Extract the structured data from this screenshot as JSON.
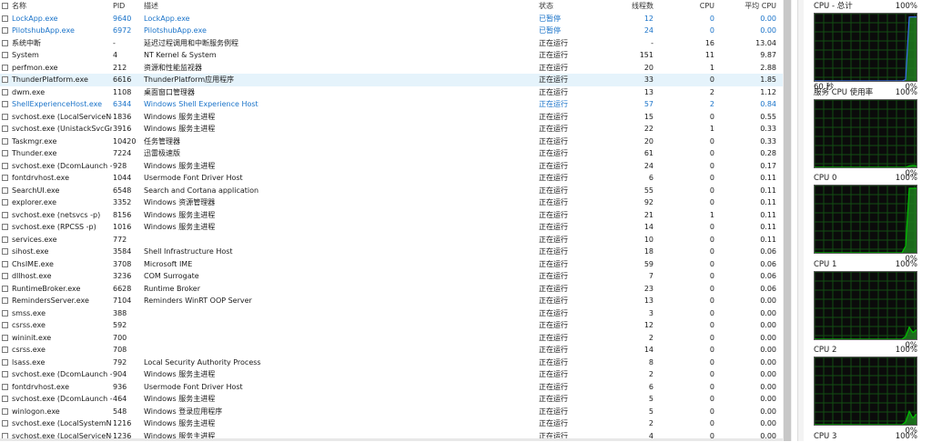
{
  "headers": {
    "name": "名称",
    "pid": "PID",
    "desc": "描述",
    "status": "状态",
    "threads": "线程数",
    "cpu": "CPU",
    "avg": "平均 CPU"
  },
  "processes": [
    {
      "name": "LockApp.exe",
      "pid": "9640",
      "desc": "LockApp.exe",
      "status": "已暂停",
      "threads": "12",
      "cpu": "0",
      "avg": "0.00",
      "suspended": true
    },
    {
      "name": "PilotshubApp.exe",
      "pid": "6972",
      "desc": "PilotshubApp.exe",
      "status": "已暂停",
      "threads": "24",
      "cpu": "0",
      "avg": "0.00",
      "suspended": true
    },
    {
      "name": "系统中断",
      "pid": "-",
      "desc": "延迟过程调用和中断服务例程",
      "status": "正在运行",
      "threads": "-",
      "cpu": "16",
      "avg": "13.04"
    },
    {
      "name": "System",
      "pid": "4",
      "desc": "NT Kernel & System",
      "status": "正在运行",
      "threads": "151",
      "cpu": "11",
      "avg": "9.87"
    },
    {
      "name": "perfmon.exe",
      "pid": "212",
      "desc": "资源和性能监视器",
      "status": "正在运行",
      "threads": "20",
      "cpu": "1",
      "avg": "2.88"
    },
    {
      "name": "ThunderPlatform.exe",
      "pid": "6616",
      "desc": "ThunderPlatform应用程序",
      "status": "正在运行",
      "threads": "33",
      "cpu": "0",
      "avg": "1.85",
      "selected": true
    },
    {
      "name": "dwm.exe",
      "pid": "1108",
      "desc": "桌面窗口管理器",
      "status": "正在运行",
      "threads": "13",
      "cpu": "2",
      "avg": "1.12"
    },
    {
      "name": "ShellExperienceHost.exe",
      "pid": "6344",
      "desc": "Windows Shell Experience Host",
      "status": "正在运行",
      "threads": "57",
      "cpu": "2",
      "avg": "0.84",
      "suspended": true
    },
    {
      "name": "svchost.exe (LocalServiceNo...",
      "pid": "1836",
      "desc": "Windows 服务主进程",
      "status": "正在运行",
      "threads": "15",
      "cpu": "0",
      "avg": "0.55"
    },
    {
      "name": "svchost.exe (UnistackSvcGro...",
      "pid": "3916",
      "desc": "Windows 服务主进程",
      "status": "正在运行",
      "threads": "22",
      "cpu": "1",
      "avg": "0.33"
    },
    {
      "name": "Taskmgr.exe",
      "pid": "10420",
      "desc": "任务管理器",
      "status": "正在运行",
      "threads": "20",
      "cpu": "0",
      "avg": "0.33"
    },
    {
      "name": "Thunder.exe",
      "pid": "7224",
      "desc": "迅雷极速版",
      "status": "正在运行",
      "threads": "61",
      "cpu": "0",
      "avg": "0.28"
    },
    {
      "name": "svchost.exe (DcomLaunch -p)",
      "pid": "928",
      "desc": "Windows 服务主进程",
      "status": "正在运行",
      "threads": "24",
      "cpu": "0",
      "avg": "0.17"
    },
    {
      "name": "fontdrvhost.exe",
      "pid": "1044",
      "desc": "Usermode Font Driver Host",
      "status": "正在运行",
      "threads": "6",
      "cpu": "0",
      "avg": "0.11"
    },
    {
      "name": "SearchUI.exe",
      "pid": "6548",
      "desc": "Search and Cortana application",
      "status": "正在运行",
      "threads": "55",
      "cpu": "0",
      "avg": "0.11"
    },
    {
      "name": "explorer.exe",
      "pid": "3352",
      "desc": "Windows 资源管理器",
      "status": "正在运行",
      "threads": "92",
      "cpu": "0",
      "avg": "0.11"
    },
    {
      "name": "svchost.exe (netsvcs -p)",
      "pid": "8156",
      "desc": "Windows 服务主进程",
      "status": "正在运行",
      "threads": "21",
      "cpu": "1",
      "avg": "0.11"
    },
    {
      "name": "svchost.exe (RPCSS -p)",
      "pid": "1016",
      "desc": "Windows 服务主进程",
      "status": "正在运行",
      "threads": "14",
      "cpu": "0",
      "avg": "0.11"
    },
    {
      "name": "services.exe",
      "pid": "772",
      "desc": "",
      "status": "正在运行",
      "threads": "10",
      "cpu": "0",
      "avg": "0.11"
    },
    {
      "name": "sihost.exe",
      "pid": "3584",
      "desc": "Shell Infrastructure Host",
      "status": "正在运行",
      "threads": "18",
      "cpu": "0",
      "avg": "0.06"
    },
    {
      "name": "ChsIME.exe",
      "pid": "3708",
      "desc": "Microsoft IME",
      "status": "正在运行",
      "threads": "59",
      "cpu": "0",
      "avg": "0.06"
    },
    {
      "name": "dllhost.exe",
      "pid": "3236",
      "desc": "COM Surrogate",
      "status": "正在运行",
      "threads": "7",
      "cpu": "0",
      "avg": "0.06"
    },
    {
      "name": "RuntimeBroker.exe",
      "pid": "6628",
      "desc": "Runtime Broker",
      "status": "正在运行",
      "threads": "23",
      "cpu": "0",
      "avg": "0.06"
    },
    {
      "name": "RemindersServer.exe",
      "pid": "7104",
      "desc": "Reminders WinRT OOP Server",
      "status": "正在运行",
      "threads": "13",
      "cpu": "0",
      "avg": "0.00"
    },
    {
      "name": "smss.exe",
      "pid": "388",
      "desc": "",
      "status": "正在运行",
      "threads": "3",
      "cpu": "0",
      "avg": "0.00"
    },
    {
      "name": "csrss.exe",
      "pid": "592",
      "desc": "",
      "status": "正在运行",
      "threads": "12",
      "cpu": "0",
      "avg": "0.00"
    },
    {
      "name": "wininit.exe",
      "pid": "700",
      "desc": "",
      "status": "正在运行",
      "threads": "2",
      "cpu": "0",
      "avg": "0.00"
    },
    {
      "name": "csrss.exe",
      "pid": "708",
      "desc": "",
      "status": "正在运行",
      "threads": "14",
      "cpu": "0",
      "avg": "0.00"
    },
    {
      "name": "lsass.exe",
      "pid": "792",
      "desc": "Local Security Authority Process",
      "status": "正在运行",
      "threads": "8",
      "cpu": "0",
      "avg": "0.00"
    },
    {
      "name": "svchost.exe (DcomLaunch -p)",
      "pid": "904",
      "desc": "Windows 服务主进程",
      "status": "正在运行",
      "threads": "2",
      "cpu": "0",
      "avg": "0.00"
    },
    {
      "name": "fontdrvhost.exe",
      "pid": "936",
      "desc": "Usermode Font Driver Host",
      "status": "正在运行",
      "threads": "6",
      "cpu": "0",
      "avg": "0.00"
    },
    {
      "name": "svchost.exe (DcomLaunch -p)",
      "pid": "464",
      "desc": "Windows 服务主进程",
      "status": "正在运行",
      "threads": "5",
      "cpu": "0",
      "avg": "0.00"
    },
    {
      "name": "winlogon.exe",
      "pid": "548",
      "desc": "Windows 登录应用程序",
      "status": "正在运行",
      "threads": "5",
      "cpu": "0",
      "avg": "0.00"
    },
    {
      "name": "svchost.exe (LocalSystemNet...",
      "pid": "1216",
      "desc": "Windows 服务主进程",
      "status": "正在运行",
      "threads": "2",
      "cpu": "0",
      "avg": "0.00"
    },
    {
      "name": "svchost.exe (LocalServiceNet...",
      "pid": "1236",
      "desc": "Windows 服务主进程",
      "status": "正在运行",
      "threads": "4",
      "cpu": "0",
      "avg": "0.00"
    }
  ],
  "graphs": [
    {
      "title": "CPU - 总计",
      "max": "100%",
      "footer_left": "60 秒",
      "footer_right": "0%",
      "line_color": "#3a6ff0",
      "fill_color": "#1f7a1f",
      "values": [
        0,
        0,
        0,
        0,
        0,
        0,
        0,
        0,
        0,
        0,
        0,
        0,
        0,
        0,
        0,
        0,
        0,
        0,
        0,
        0,
        0,
        0,
        0,
        0,
        0,
        2,
        95,
        95,
        95
      ]
    },
    {
      "title": "服务 CPU 使用率",
      "max": "100%",
      "footer_left": "",
      "footer_right": "0%",
      "line_color": "#00c000",
      "fill_color": "#1f7a1f",
      "values": [
        0,
        0,
        0,
        0,
        0,
        0,
        0,
        0,
        0,
        0,
        0,
        0,
        0,
        0,
        0,
        0,
        0,
        0,
        0,
        0,
        0,
        0,
        0,
        0,
        0,
        0,
        2,
        3,
        2
      ]
    },
    {
      "title": "CPU 0",
      "max": "100%",
      "footer_left": "",
      "footer_right": "0%",
      "line_color": "#00c000",
      "fill_color": "#1f7a1f",
      "values": [
        0,
        0,
        0,
        0,
        0,
        0,
        0,
        0,
        0,
        0,
        0,
        0,
        0,
        0,
        0,
        0,
        0,
        0,
        0,
        0,
        0,
        0,
        0,
        0,
        0,
        10,
        96,
        96,
        96
      ]
    },
    {
      "title": "CPU 1",
      "max": "100%",
      "footer_left": "",
      "footer_right": "0%",
      "line_color": "#00c000",
      "fill_color": "#1f7a1f",
      "values": [
        0,
        0,
        0,
        0,
        0,
        0,
        0,
        0,
        0,
        0,
        0,
        0,
        0,
        0,
        0,
        0,
        0,
        0,
        0,
        0,
        0,
        0,
        0,
        0,
        0,
        4,
        18,
        10,
        14
      ]
    },
    {
      "title": "CPU 2",
      "max": "100%",
      "footer_left": "",
      "footer_right": "0%",
      "line_color": "#00c000",
      "fill_color": "#1f7a1f",
      "values": [
        0,
        0,
        0,
        0,
        0,
        0,
        0,
        0,
        0,
        0,
        0,
        0,
        0,
        0,
        0,
        0,
        0,
        0,
        0,
        0,
        0,
        0,
        0,
        0,
        0,
        4,
        20,
        10,
        16
      ]
    },
    {
      "title": "CPU 3",
      "max": "100%",
      "footer_left": "",
      "footer_right": "",
      "line_color": "#00c000",
      "fill_color": "#1f7a1f",
      "values": []
    }
  ]
}
